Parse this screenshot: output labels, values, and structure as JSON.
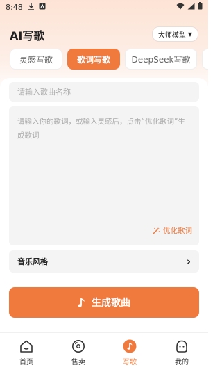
{
  "status": {
    "time": "8:48"
  },
  "header": {
    "title": "AI写歌",
    "model_label": "大师模型",
    "model_arrow": "▼"
  },
  "tabs": [
    {
      "label": "灵感写歌",
      "active": false
    },
    {
      "label": "歌词写歌",
      "active": true
    },
    {
      "label": "DeepSeek写歌",
      "active": false
    },
    {
      "label": "",
      "active": false
    }
  ],
  "form": {
    "song_name_placeholder": "请输入歌曲名称",
    "lyrics_placeholder": "请输入你的歌词，或输入灵感后，点击“优化歌词”生成歌词",
    "optimize_label": "优化歌词",
    "style_label": "音乐风格",
    "style_arrow": "›",
    "generate_label": "生成歌曲"
  },
  "nav": [
    {
      "label": "首页",
      "icon": "home-icon",
      "active": false
    },
    {
      "label": "售卖",
      "icon": "disc-icon",
      "active": false
    },
    {
      "label": "写歌",
      "icon": "music-note-icon",
      "active": true
    },
    {
      "label": "我的",
      "icon": "profile-icon",
      "active": false
    }
  ],
  "colors": {
    "accent": "#f07a3e",
    "header_bg": "#fde3d5",
    "field_bg": "#f4f4f4"
  }
}
